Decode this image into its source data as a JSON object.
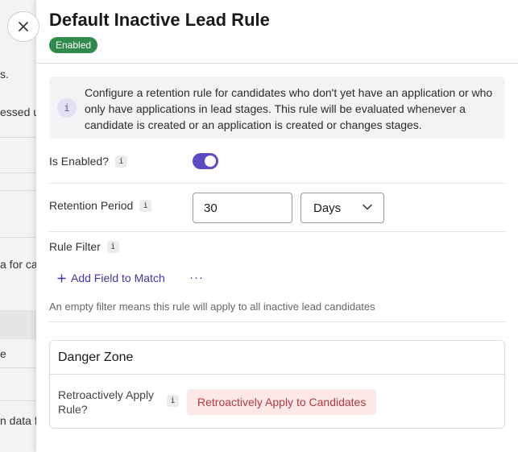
{
  "background": {
    "fragments": [
      "s.",
      "essed u",
      "a for ca",
      "e",
      "n data f"
    ]
  },
  "drawer": {
    "title": "Default Inactive Lead Rule",
    "status_badge": "Enabled",
    "info": {
      "icon": "i",
      "text": "Configure a retention rule for candidates who don't yet have an application or who only have applications in lead stages. This rule will be evaluated whenever a candidate is created or an application is created or changes stages."
    },
    "is_enabled": {
      "label": "Is Enabled?",
      "tip": "i",
      "value": true
    },
    "retention_period": {
      "label": "Retention Period",
      "tip": "i",
      "value": "30",
      "unit": "Days"
    },
    "rule_filter": {
      "label": "Rule Filter",
      "tip": "i",
      "add_field_label": "Add Field to Match",
      "more_label": "···",
      "helper": "An empty filter means this rule will apply to all inactive lead candidates"
    },
    "danger_zone": {
      "title": "Danger Zone",
      "label": "Retroactively Apply Rule?",
      "tip": "i",
      "button_label": "Retroactively Apply to Candidates"
    }
  },
  "icons": {
    "close": "close-icon",
    "chevron": "chevron-down-icon",
    "plus": "plus-icon"
  },
  "colors": {
    "accent": "#5b4bc4",
    "badge": "#2f8a4c",
    "danger_bg": "#fde8e8",
    "danger_text": "#b23b3b",
    "link": "#3d3aa8"
  }
}
